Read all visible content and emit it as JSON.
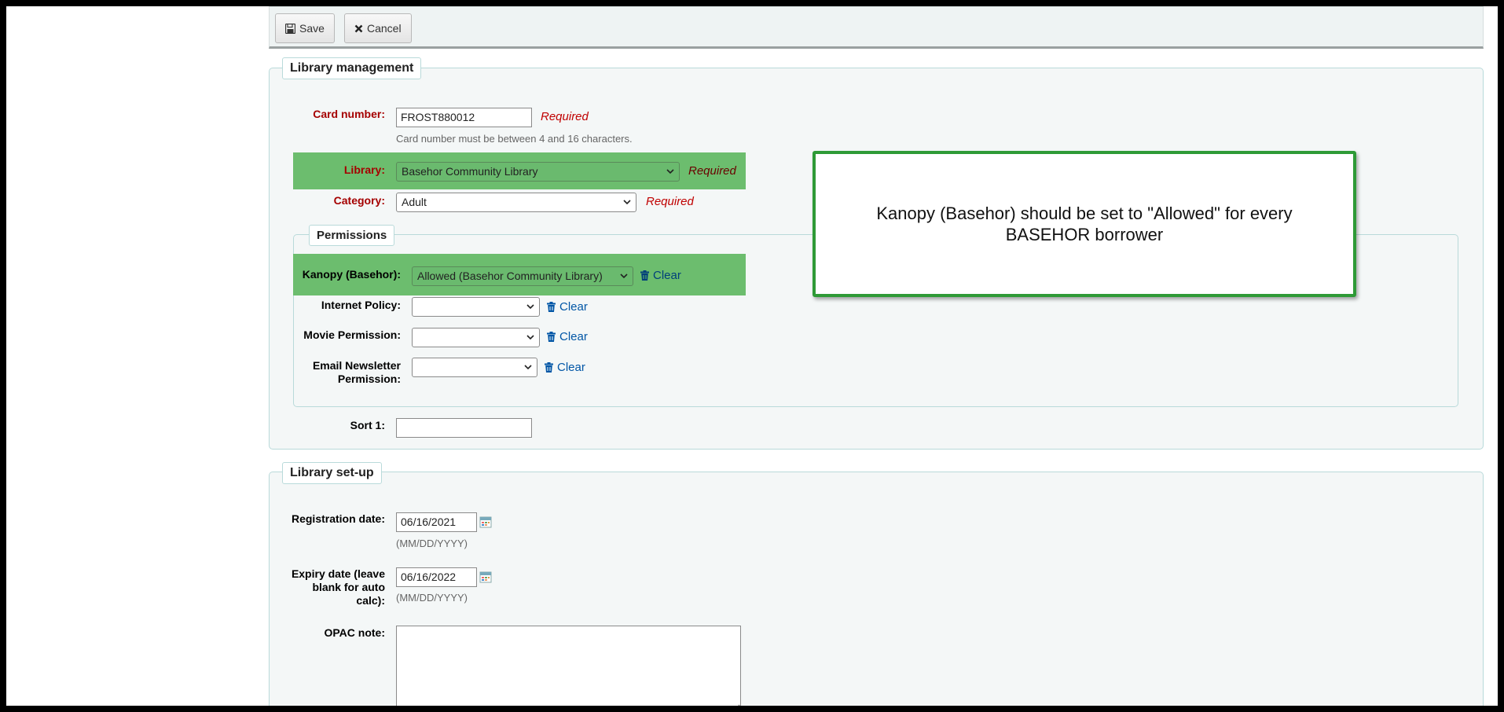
{
  "toolbar": {
    "save_label": "Save",
    "cancel_label": "Cancel"
  },
  "library_management": {
    "legend": "Library management",
    "card_number": {
      "label": "Card number:",
      "value": "FROST880012",
      "required": "Required",
      "hint": "Card number must be between 4 and 16 characters."
    },
    "library": {
      "label": "Library:",
      "value": "Basehor Community Library",
      "required": "Required"
    },
    "category": {
      "label": "Category:",
      "value": "Adult",
      "required": "Required"
    },
    "permissions": {
      "legend": "Permissions",
      "clear_label": "Clear",
      "kanopy": {
        "label": "Kanopy (Basehor):",
        "value": "Allowed (Basehor Community Library)"
      },
      "internet": {
        "label": "Internet Policy:",
        "value": ""
      },
      "movie": {
        "label": "Movie Permission:",
        "value": ""
      },
      "email_line1": "Email Newsletter",
      "email_line2": "Permission:",
      "email_value": ""
    },
    "sort1": {
      "label": "Sort 1:",
      "value": ""
    }
  },
  "library_setup": {
    "legend": "Library set-up",
    "registration": {
      "label": "Registration date:",
      "value": "06/16/2021",
      "format": "(MM/DD/YYYY)"
    },
    "expiry": {
      "label_line1": "Expiry date (leave",
      "label_line2": "blank for auto",
      "label_line3": "calc):",
      "value": "06/16/2022",
      "format": "(MM/DD/YYYY)"
    },
    "opac_note": {
      "label": "OPAC note:"
    }
  },
  "callout": {
    "text": "Kanopy (Basehor) should be set to \"Allowed\" for every BASEHOR borrower"
  },
  "colors": {
    "highlight": "#6cbd6e",
    "required": "#c00000",
    "link": "#0056a6",
    "callout_border": "#2e9a36"
  },
  "icons": [
    "save-icon",
    "cancel-x-icon",
    "chevron-down-icon",
    "trash-icon",
    "calendar-icon"
  ]
}
